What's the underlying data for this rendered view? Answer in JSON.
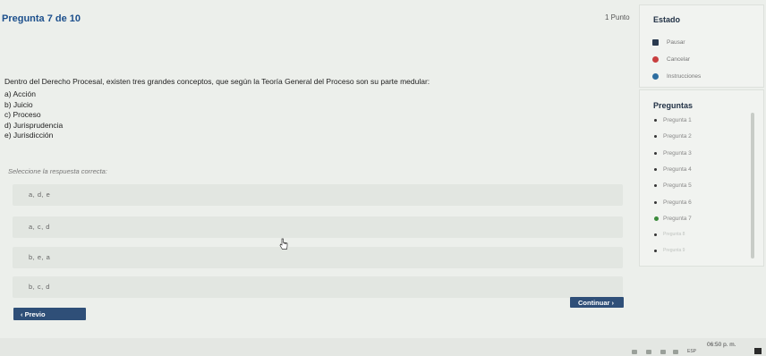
{
  "quiz": {
    "title": "Pregunta 7 de 10",
    "points": "1 Punto",
    "question": "Dentro del Derecho Procesal, existen tres grandes conceptos, que según la Teoría General del Proceso son su parte medular:",
    "options": [
      "a) Acción",
      "b) Juicio",
      "c) Proceso",
      "d) Jurisprudencia",
      "e) Jurisdicción"
    ],
    "instruction": "Seleccione la respuesta correcta:",
    "answers": [
      "a, d, e",
      "a, c, d",
      "b, e, a",
      "b, c, d"
    ],
    "prev_label": "Previo",
    "next_label": "Continuar"
  },
  "sidebar": {
    "estado_title": "Estado",
    "estado_items": [
      {
        "label": "Pausar",
        "icon": "pause-icon"
      },
      {
        "label": "Cancelar",
        "icon": "cancel-icon"
      },
      {
        "label": "Instrucciones",
        "icon": "info-icon"
      }
    ],
    "preguntas_title": "Preguntas",
    "preguntas": [
      "Pregunta 1",
      "Pregunta 2",
      "Pregunta 3",
      "Pregunta 4",
      "Pregunta 5",
      "Pregunta 6",
      "Pregunta 7",
      "Pregunta 8",
      "Pregunta 9"
    ],
    "current_index": 6
  },
  "taskbar": {
    "time": "06:50 p. m.",
    "lang": "ESP"
  },
  "colors": {
    "accent": "#2f4f78",
    "title": "#1c4f8c",
    "current": "#3b8a3b"
  }
}
